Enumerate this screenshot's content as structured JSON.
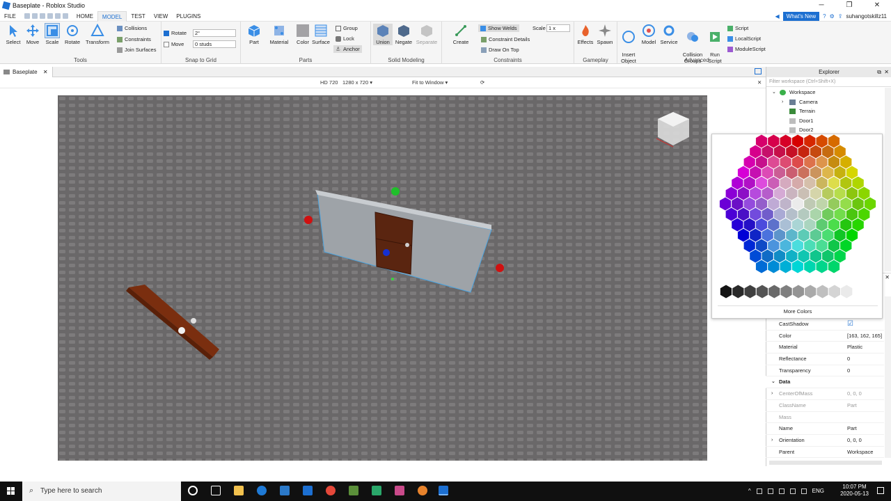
{
  "window": {
    "title": "Baseplate - Roblox Studio",
    "minimize": "─",
    "maximize": "❐",
    "close": "✕"
  },
  "menubar": {
    "file": "FILE",
    "tabs": [
      "HOME",
      "MODEL",
      "TEST",
      "VIEW",
      "PLUGINS"
    ],
    "active_tab": "MODEL",
    "whats_new": "What's New",
    "username": "suhangotskillz11"
  },
  "ribbon": {
    "tools": {
      "label": "Tools",
      "buttons": [
        "Select",
        "Move",
        "Scale",
        "Rotate",
        "Transform"
      ],
      "selected": "Scale"
    },
    "tools_small": [
      "Collisions",
      "Constraints",
      "Join Surfaces"
    ],
    "snap": {
      "label": "Snap to Grid",
      "rotate_label": "Rotate",
      "rotate_value": "2°",
      "move_label": "Move",
      "move_value": "0 studs"
    },
    "parts": {
      "label": "Parts",
      "buttons": [
        "Part",
        "Material",
        "Color",
        "Surface"
      ]
    },
    "parts_small": [
      "Group",
      "Lock",
      "Anchor"
    ],
    "solid": {
      "label": "Solid Modeling",
      "buttons": [
        "Union",
        "Negate",
        "Separate"
      ]
    },
    "constraints": {
      "label": "Constraints",
      "create": "Create",
      "show_welds": "Show Welds",
      "scale_label": "Scale",
      "scale_value": "1 x",
      "details": "Constraint Details",
      "draw_on_top": "Draw On Top"
    },
    "gameplay": {
      "label": "Gameplay",
      "buttons": [
        "Effects",
        "Spawn"
      ]
    },
    "advanced": {
      "label": "Advanced",
      "insert_object": "Insert\nObject",
      "model": "Model",
      "service": "Service",
      "collision_groups": "Collision\nGroups",
      "run_script": "Run\nScript",
      "scripts": [
        "Script",
        "LocalScript",
        "ModuleScript"
      ]
    }
  },
  "doc": {
    "tab": "Baseplate"
  },
  "viewbar": {
    "preset": "HD 720",
    "resolution": "1280 x 720",
    "fit": "Fit to Window"
  },
  "explorer": {
    "title": "Explorer",
    "filter_placeholder": "Filter workspace (Ctrl+Shift+X)",
    "items": [
      "Workspace",
      "Camera",
      "Terrain",
      "Door1",
      "Door2"
    ]
  },
  "palette": {
    "more_colors": "More Colors"
  },
  "properties": {
    "rows": [
      {
        "name": "CastShadow",
        "value": "☑"
      },
      {
        "name": "Color",
        "value": "[163, 162, 165]"
      },
      {
        "name": "Material",
        "value": "Plastic"
      },
      {
        "name": "Reflectance",
        "value": "0"
      },
      {
        "name": "Transparency",
        "value": "0"
      },
      {
        "name": "Data",
        "value": ""
      },
      {
        "name": "CenterOfMass",
        "value": "0, 0, 0"
      },
      {
        "name": "ClassName",
        "value": "Part"
      },
      {
        "name": "Mass",
        "value": ""
      },
      {
        "name": "Name",
        "value": "Part"
      },
      {
        "name": "Orientation",
        "value": "0, 0, 0"
      },
      {
        "name": "Parent",
        "value": "Workspace"
      }
    ]
  },
  "taskbar": {
    "search_placeholder": "Type here to search",
    "lang": "ENG",
    "time": "10:07 PM",
    "date": "2020-05-13"
  },
  "colors": {
    "accent": "#1c6fd1",
    "selection": "#4aa3df"
  }
}
